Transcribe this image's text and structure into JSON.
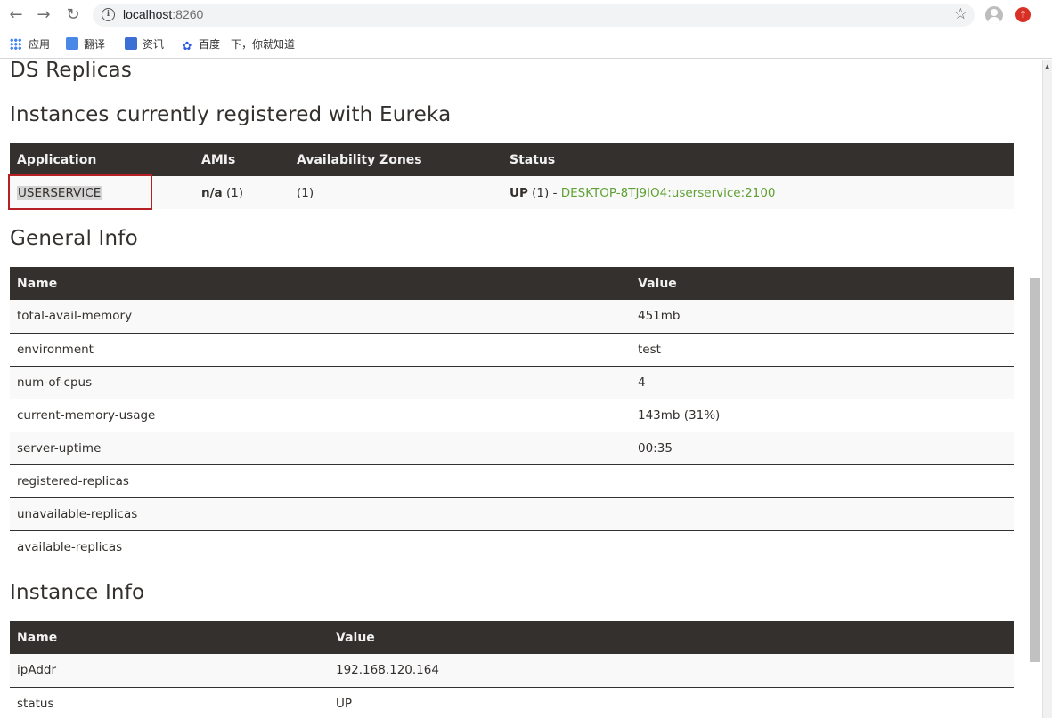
{
  "browser": {
    "url_host": "localhost",
    "url_port": ":8260",
    "bookmarks": [
      "应用",
      "翻译",
      "资讯",
      "百度一下，你就知道"
    ]
  },
  "page": {
    "ds_replicas_heading": "DS Replicas",
    "instances_heading": "Instances currently registered with Eureka",
    "general_heading": "General Info",
    "instance_info_heading": "Instance Info"
  },
  "instances_table": {
    "headers": [
      "Application",
      "AMIs",
      "Availability Zones",
      "Status"
    ],
    "row": {
      "application": "USERSERVICE",
      "amis_value": "n/a",
      "amis_count": "(1)",
      "zones": "(1)",
      "status_value": "UP",
      "status_count": "(1) -",
      "status_link": "DESKTOP-8TJ9IO4:userservice:2100"
    }
  },
  "general_table": {
    "headers": [
      "Name",
      "Value"
    ],
    "rows": [
      {
        "name": "total-avail-memory",
        "value": "451mb"
      },
      {
        "name": "environment",
        "value": "test"
      },
      {
        "name": "num-of-cpus",
        "value": "4"
      },
      {
        "name": "current-memory-usage",
        "value": "143mb (31%)"
      },
      {
        "name": "server-uptime",
        "value": "00:35"
      },
      {
        "name": "registered-replicas",
        "value": ""
      },
      {
        "name": "unavailable-replicas",
        "value": ""
      },
      {
        "name": "available-replicas",
        "value": ""
      }
    ]
  },
  "instance_table": {
    "headers": [
      "Name",
      "Value"
    ],
    "rows": [
      {
        "name": "ipAddr",
        "value": "192.168.120.164"
      },
      {
        "name": "status",
        "value": "UP"
      }
    ]
  },
  "colors": {
    "header_bg": "#34302d",
    "link_green": "#5fa134",
    "highlight_border": "#b52025"
  }
}
